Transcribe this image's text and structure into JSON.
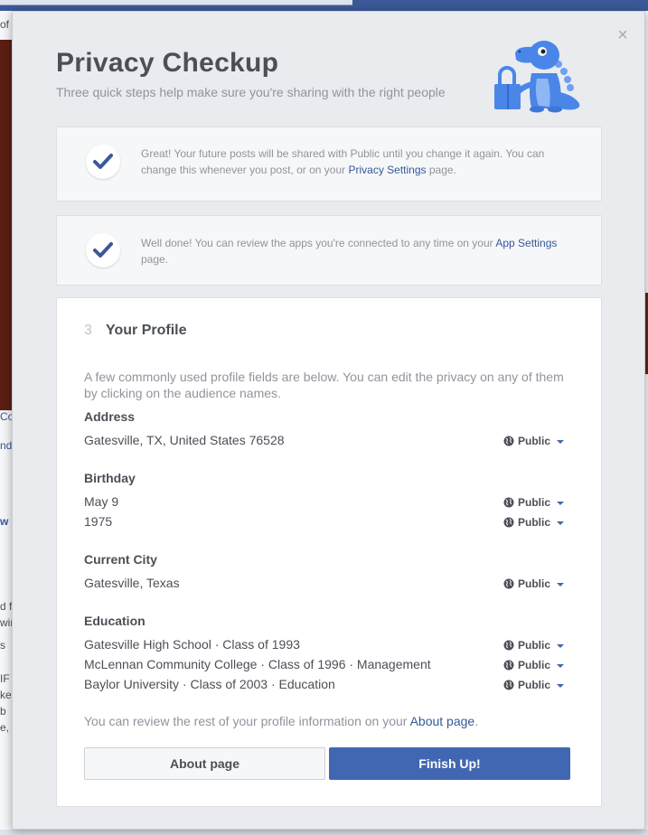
{
  "background": {
    "left_fragments": [
      "of",
      "Co",
      "nda",
      "w",
      "d f",
      "win",
      "s",
      "IF",
      "ke",
      "b",
      "e,"
    ]
  },
  "modal": {
    "close_label": "×",
    "title": "Privacy Checkup",
    "subtitle": "Three quick steps help make sure you're sharing with the right people",
    "illustration_icon": "dinosaur-mascot-with-padlock",
    "step1": {
      "text_before": "Great! Your future posts will be shared with Public until you change it again. You can change this whenever you post, or on your ",
      "link": "Privacy Settings",
      "text_after": " page."
    },
    "step2": {
      "text_before": "Well done! You can review the apps you're connected to any time on your ",
      "link": "App Settings",
      "text_after": " page."
    },
    "step3": {
      "number": "3",
      "title": "Your Profile",
      "intro": "A few commonly used profile fields are below. You can edit the privacy on any of them by clicking on the audience names.",
      "fields": [
        {
          "label": "Address",
          "values": [
            "Gatesville, TX, United States 76528"
          ]
        },
        {
          "label": "Birthday",
          "values": [
            "May 9",
            "1975"
          ]
        },
        {
          "label": "Current City",
          "values": [
            "Gatesville, Texas"
          ]
        },
        {
          "label": "Education",
          "values": [
            "Gatesville High School · Class of 1993",
            "McLennan Community College · Class of 1996 · Management",
            "Baylor University · Class of 2003 · Education"
          ]
        }
      ],
      "audience_label": "Public",
      "footer_text": "You can review the rest of your profile information on your ",
      "footer_link": "About page",
      "footer_end": ".",
      "about_button": "About page",
      "finish_button": "Finish Up!"
    }
  },
  "colors": {
    "brand_blue": "#4267b2",
    "link_blue": "#365899",
    "check_blue": "#3b5998",
    "muted_text": "#90949c",
    "dino_blue": "#4a86e8"
  }
}
